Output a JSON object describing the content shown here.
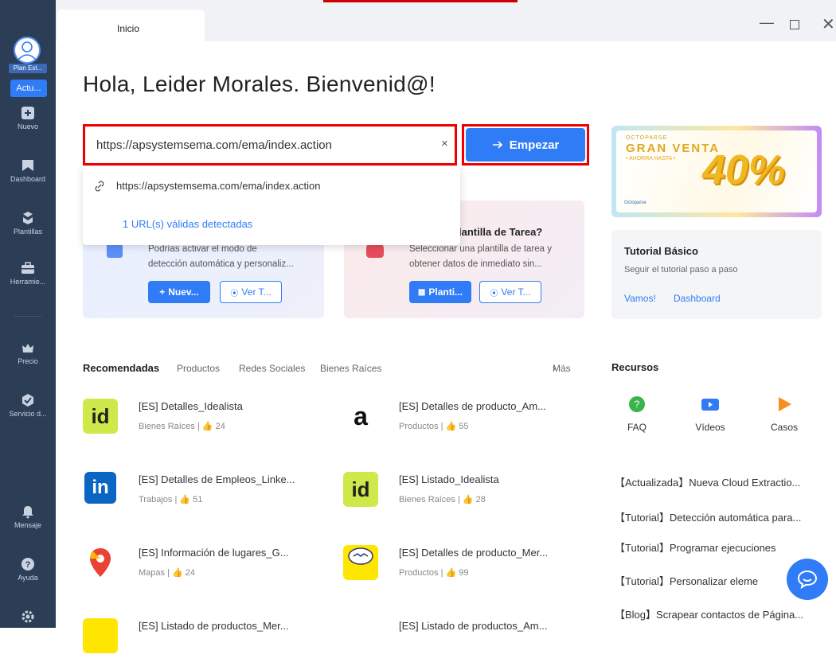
{
  "sidebar": {
    "avatar_plan": "Plan Est...",
    "update_badge": "Actu...",
    "items": [
      {
        "label": "Nuevo",
        "icon": "plus-icon"
      },
      {
        "label": "Dashboard",
        "icon": "dashboard-icon"
      },
      {
        "label": "Plantillas",
        "icon": "template-icon"
      },
      {
        "label": "Herramie...",
        "icon": "toolbox-icon"
      },
      {
        "label": "Precio",
        "icon": "crown-icon"
      },
      {
        "label": "Servicio d...",
        "icon": "service-icon"
      },
      {
        "label": "Mensaje",
        "icon": "bell-icon"
      },
      {
        "label": "Ayuda",
        "icon": "help-icon"
      }
    ]
  },
  "tabs": {
    "home": "Inicio"
  },
  "header": {
    "greeting": "Hola, Leider Morales. Bienvenid@!"
  },
  "url_bar": {
    "value": "https://apsystemsema.com/ema/index.action",
    "start_label": "Empezar",
    "clear": "×"
  },
  "dropdown": {
    "suggestion": "https://apsystemsema.com/ema/index.action",
    "valid_text": "1 URL(s) válidas detectadas"
  },
  "card_custom": {
    "desc_line1": "Podrías activar el modo de",
    "desc_line2": "detección automática y personaliz...",
    "new_btn": "Nuev...",
    "view_btn": "Ver T..."
  },
  "card_template": {
    "title": "lantilla de Tarea?",
    "desc_line1": "Seleccionar una plantilla de tarea y",
    "desc_line2": "obtener datos de inmediato sin...",
    "template_btn": "Planti...",
    "view_btn": "Ver T..."
  },
  "promo": {
    "brand": "OCTOPARSE",
    "headline": "GRAN VENTA",
    "sub": "• AHORRA HASTA •",
    "percent": "40%",
    "logo": "Octoparse"
  },
  "tutorial": {
    "title": "Tutorial Básico",
    "desc": "Seguir el tutorial paso a paso",
    "link1": "Vamos!",
    "link2": "Dashboard"
  },
  "rec_tabs": {
    "active": "Recomendadas",
    "t1": "Productos",
    "t2": "Redes Sociales",
    "t3": "Bienes Raíces",
    "more": "Más"
  },
  "recommended": [
    {
      "title": "[ES] Detalles_Idealista",
      "meta": "Bienes Raíces",
      "likes": "24"
    },
    {
      "title": "[ES] Detalles de producto_Am...",
      "meta": "Productos",
      "likes": "55"
    },
    {
      "title": "[ES] Detalles de Empleos_Linke...",
      "meta": "Trabajos",
      "likes": "51"
    },
    {
      "title": "[ES] Listado_Idealista",
      "meta": "Bienes Raíces",
      "likes": "28"
    },
    {
      "title": "[ES] Información de lugares_G...",
      "meta": "Mapas",
      "likes": "24"
    },
    {
      "title": "[ES] Detalles de producto_Mer...",
      "meta": "Productos",
      "likes": "99"
    },
    {
      "title": "[ES] Listado de productos_Mer...",
      "meta": "",
      "likes": ""
    },
    {
      "title": "[ES] Listado de productos_Am...",
      "meta": "",
      "likes": ""
    }
  ],
  "resources": {
    "title": "Recursos",
    "faq": "FAQ",
    "videos": "Vídeos",
    "cases": "Casos",
    "links": [
      "【Actualizada】Nueva Cloud Extractio...",
      "【Tutorial】Detección automática para...",
      "【Tutorial】Programar ejecuciones",
      "【Tutorial】Personalizar eleme",
      "【Blog】Scrapear contactos de Página..."
    ]
  },
  "colors": {
    "accent": "#2f7cf6",
    "sidebar": "#2c3e55",
    "highlight": "#e00000"
  }
}
